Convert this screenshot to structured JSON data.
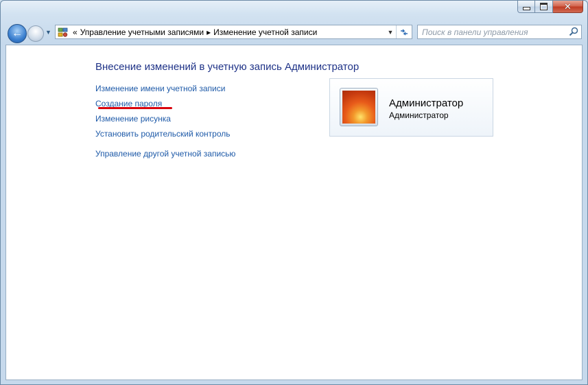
{
  "window": {
    "minimize_icon": "minimize-icon",
    "maximize_icon": "maximize-icon",
    "close_icon": "close-icon",
    "close_color": "#c7462d"
  },
  "navigation": {
    "back_icon": "arrow-left-icon",
    "forward_icon": "arrow-right-icon",
    "history_icon": "chevron-down-icon"
  },
  "address": {
    "overflow_symbol": "«",
    "separator": "▸",
    "crumbs": [
      "Управление учетными записями",
      "Изменение учетной записи"
    ],
    "refresh_icon": "refresh-icon"
  },
  "search": {
    "placeholder": "Поиск в панели управления",
    "value": ""
  },
  "main": {
    "heading": "Внесение изменений в учетную запись Администратор",
    "links": [
      "Изменение имени учетной записи",
      "Создание пароля",
      "Изменение рисунка",
      "Установить родительский контроль"
    ],
    "other_account_link": "Управление другой учетной записью",
    "highlight_color": "#d9000c",
    "link_color": "#1e5aa8",
    "heading_color": "#1e3287"
  },
  "account": {
    "name": "Администратор",
    "role": "Администратор",
    "picture": "flower-avatar"
  }
}
